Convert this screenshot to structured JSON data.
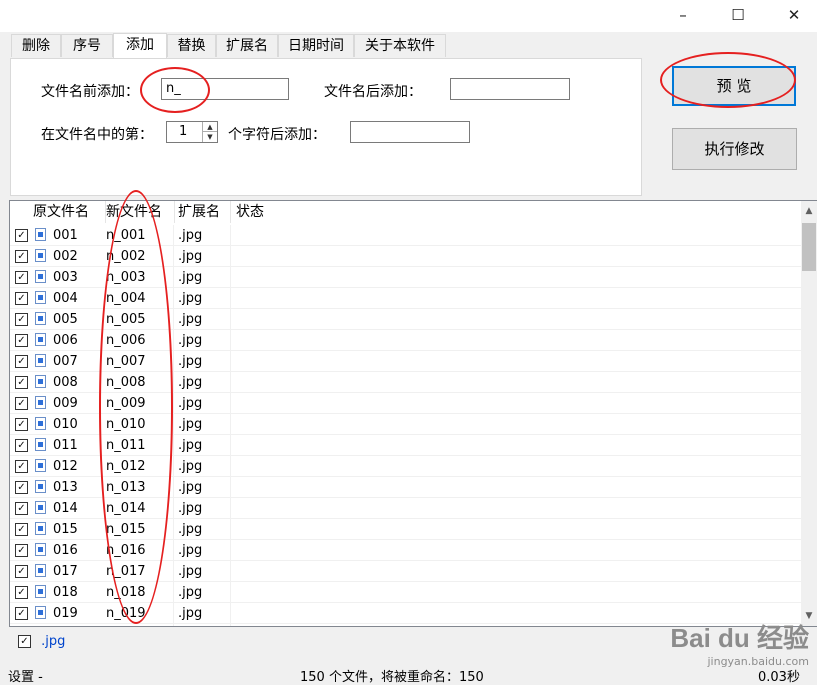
{
  "window": {
    "minimize_glyph": "–",
    "maximize_glyph": "☐",
    "close_glyph": "✕"
  },
  "tabs": [
    {
      "label": "删除"
    },
    {
      "label": "序号"
    },
    {
      "label": "添加"
    },
    {
      "label": "替换"
    },
    {
      "label": "扩展名"
    },
    {
      "label": "日期时间"
    },
    {
      "label": "关于本软件"
    }
  ],
  "add_panel": {
    "prefix_label": "文件名前添加：",
    "prefix_value": "n_",
    "suffix_label": "文件名后添加：",
    "suffix_value": "",
    "position_label": "在文件名中的第：",
    "position_value": "1",
    "position_after_label": "个字符后添加：",
    "position_text_value": ""
  },
  "buttons": {
    "preview": "预 览",
    "execute": "执行修改"
  },
  "list": {
    "columns": [
      "原文件名",
      "新文件名",
      "扩展名",
      "状态"
    ],
    "rows": [
      {
        "orig": "001",
        "new": "n_001",
        "ext": ".jpg",
        "status": ""
      },
      {
        "orig": "002",
        "new": "n_002",
        "ext": ".jpg",
        "status": ""
      },
      {
        "orig": "003",
        "new": "n_003",
        "ext": ".jpg",
        "status": ""
      },
      {
        "orig": "004",
        "new": "n_004",
        "ext": ".jpg",
        "status": ""
      },
      {
        "orig": "005",
        "new": "n_005",
        "ext": ".jpg",
        "status": ""
      },
      {
        "orig": "006",
        "new": "n_006",
        "ext": ".jpg",
        "status": ""
      },
      {
        "orig": "007",
        "new": "n_007",
        "ext": ".jpg",
        "status": ""
      },
      {
        "orig": "008",
        "new": "n_008",
        "ext": ".jpg",
        "status": ""
      },
      {
        "orig": "009",
        "new": "n_009",
        "ext": ".jpg",
        "status": ""
      },
      {
        "orig": "010",
        "new": "n_010",
        "ext": ".jpg",
        "status": ""
      },
      {
        "orig": "011",
        "new": "n_011",
        "ext": ".jpg",
        "status": ""
      },
      {
        "orig": "012",
        "new": "n_012",
        "ext": ".jpg",
        "status": ""
      },
      {
        "orig": "013",
        "new": "n_013",
        "ext": ".jpg",
        "status": ""
      },
      {
        "orig": "014",
        "new": "n_014",
        "ext": ".jpg",
        "status": ""
      },
      {
        "orig": "015",
        "new": "n_015",
        "ext": ".jpg",
        "status": ""
      },
      {
        "orig": "016",
        "new": "n_016",
        "ext": ".jpg",
        "status": ""
      },
      {
        "orig": "017",
        "new": "n_017",
        "ext": ".jpg",
        "status": ""
      },
      {
        "orig": "018",
        "new": "n_018",
        "ext": ".jpg",
        "status": ""
      },
      {
        "orig": "019",
        "new": "n_019",
        "ext": ".jpg",
        "status": ""
      }
    ]
  },
  "filter": {
    "ext_label": ".jpg"
  },
  "statusbar": {
    "left": "设置 -",
    "file_count": "150 个文件，将被重命名：150",
    "time": "0.03秒"
  },
  "watermark": {
    "logo": "Bai du 经验",
    "sub": "jingyan.baidu.com"
  },
  "colors": {
    "annotation_red": "#e52020",
    "focus_blue": "#0078d7",
    "link_blue": "#0044cc"
  }
}
